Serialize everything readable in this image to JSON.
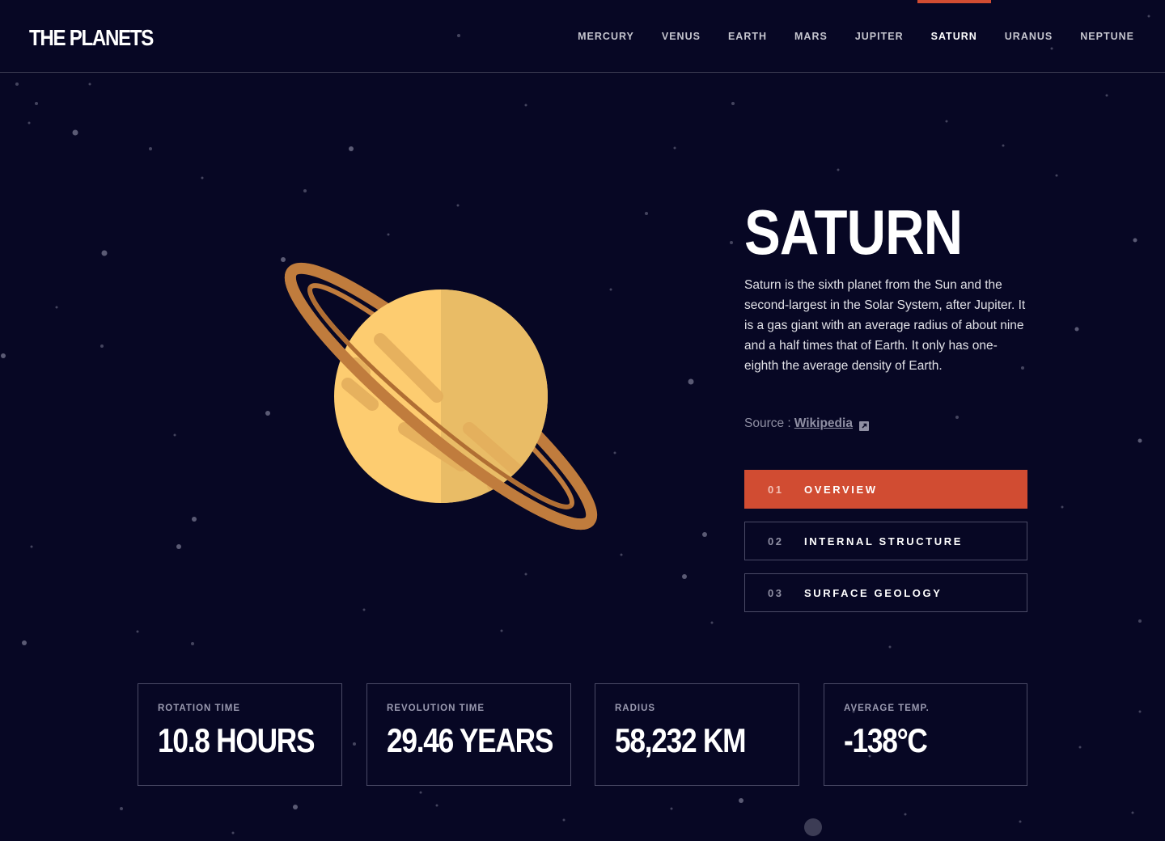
{
  "theme": {
    "accent": "#d14c32",
    "background": "#070724",
    "border": "#38384f"
  },
  "header": {
    "logo": "THE PLANETS",
    "nav": [
      {
        "label": "MERCURY",
        "active": false
      },
      {
        "label": "VENUS",
        "active": false
      },
      {
        "label": "EARTH",
        "active": false
      },
      {
        "label": "MARS",
        "active": false
      },
      {
        "label": "JUPITER",
        "active": false
      },
      {
        "label": "SATURN",
        "active": true
      },
      {
        "label": "URANUS",
        "active": false
      },
      {
        "label": "NEPTUNE",
        "active": false
      }
    ]
  },
  "planet": {
    "name": "SATURN",
    "description": "Saturn is the sixth planet from the Sun and the second-largest in the Solar System, after Jupiter. It is a gas giant with an average radius of about nine and a half times that of Earth. It only has one-eighth the average density of Earth.",
    "source_prefix": "Source :",
    "source_link": "Wikipedia",
    "source_icon": "external-link-icon",
    "illustration": "saturn-illustration"
  },
  "tabs": [
    {
      "num": "01",
      "label": "OVERVIEW",
      "active": true
    },
    {
      "num": "02",
      "label": "INTERNAL STRUCTURE",
      "active": false
    },
    {
      "num": "03",
      "label": "SURFACE GEOLOGY",
      "active": false
    }
  ],
  "stats": [
    {
      "label": "ROTATION TIME",
      "value": "10.8 HOURS"
    },
    {
      "label": "REVOLUTION TIME",
      "value": "29.46 YEARS"
    },
    {
      "label": "RADIUS",
      "value": "58,232 KM"
    },
    {
      "label": "AVERAGE TEMP.",
      "value": "-138°C"
    }
  ]
}
